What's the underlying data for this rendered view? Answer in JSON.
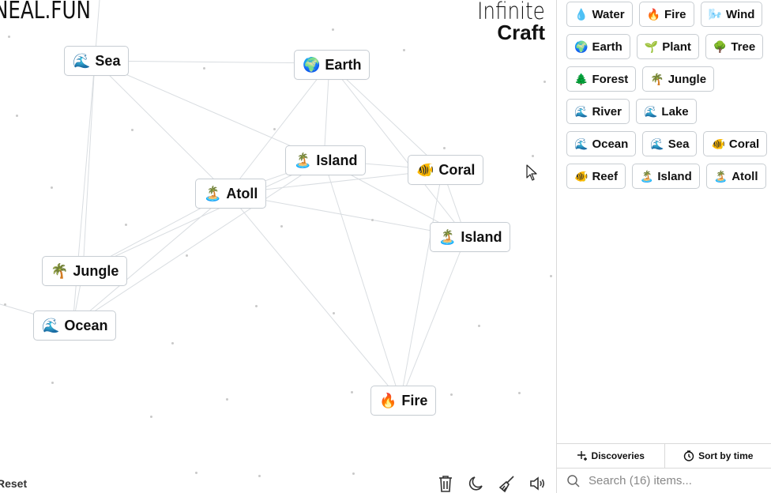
{
  "brand": "NEAL.FUN",
  "title": {
    "line1": "Infinite",
    "line2": "Craft"
  },
  "canvas_elements": [
    {
      "id": "sea",
      "emoji": "🌊",
      "label": "Sea"
    },
    {
      "id": "earth",
      "emoji": "🌍",
      "label": "Earth"
    },
    {
      "id": "island1",
      "emoji": "🏝️",
      "label": "Island"
    },
    {
      "id": "coral",
      "emoji": "🐠",
      "label": "Coral"
    },
    {
      "id": "atoll",
      "emoji": "🏝️",
      "label": "Atoll"
    },
    {
      "id": "island2",
      "emoji": "🏝️",
      "label": "Island"
    },
    {
      "id": "jungle",
      "emoji": "🌴",
      "label": "Jungle"
    },
    {
      "id": "ocean",
      "emoji": "🌊",
      "label": "Ocean"
    },
    {
      "id": "fire",
      "emoji": "🔥",
      "label": "Fire"
    }
  ],
  "sidebar_items": [
    {
      "emoji": "💧",
      "label": "Water"
    },
    {
      "emoji": "🔥",
      "label": "Fire"
    },
    {
      "emoji": "🌬️",
      "label": "Wind"
    },
    {
      "emoji": "🌍",
      "label": "Earth"
    },
    {
      "emoji": "🌱",
      "label": "Plant"
    },
    {
      "emoji": "🌳",
      "label": "Tree"
    },
    {
      "emoji": "🌲",
      "label": "Forest"
    },
    {
      "emoji": "🌴",
      "label": "Jungle"
    },
    {
      "emoji": "🌊",
      "label": "River"
    },
    {
      "emoji": "🌊",
      "label": "Lake"
    },
    {
      "emoji": "🌊",
      "label": "Ocean"
    },
    {
      "emoji": "🌊",
      "label": "Sea"
    },
    {
      "emoji": "🐠",
      "label": "Coral"
    },
    {
      "emoji": "🐠",
      "label": "Reef"
    },
    {
      "emoji": "🏝️",
      "label": "Island"
    },
    {
      "emoji": "🏝️",
      "label": "Atoll"
    }
  ],
  "controls": {
    "reset": "Reset",
    "discoveries": "Discoveries",
    "sort": "Sort by time",
    "search_placeholder": "Search (16) items..."
  },
  "icons": {
    "trash": "trash-icon",
    "moon": "moon-icon",
    "broom": "broom-icon",
    "sound": "sound-icon",
    "search": "search-icon",
    "sparkle": "sparkle-icon",
    "clock": "clock-icon"
  }
}
